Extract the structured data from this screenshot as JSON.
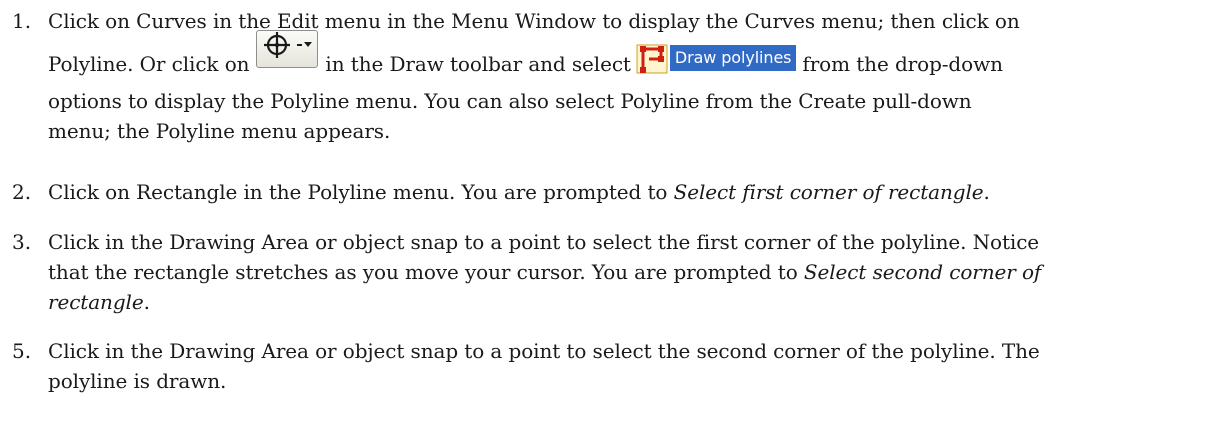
{
  "steps": [
    {
      "number": "1.",
      "line1": "Click on Curves in the Edit menu in the Menu Window to display the Curves menu; then click on",
      "line2_a": "Polyline. Or click on",
      "line2_b": "in the Draw toolbar and select",
      "line2_c": "from the drop-down",
      "line3": "options to display the Polyline menu. You can also select Polyline from the Create pull-down",
      "line4": "menu; the Polyline menu appears.",
      "menu_label": "Draw polylines",
      "toolbar_icon": "snap-target-dropdown-icon",
      "menu_icon": "polyline-icon"
    },
    {
      "number": "2.",
      "line1_a": "Click on Rectangle in the Polyline menu. You are prompted to ",
      "line1_b": "Select first corner of rectangle",
      "line1_c": "."
    },
    {
      "number": "3.",
      "line1": "Click in the Drawing Area or object snap to a point to select the first corner of the polyline. Notice",
      "line2_a": "that the rectangle stretches as you move your cursor. You are prompted to ",
      "line2_b": "Select second corner of",
      "line3_a": "rectangle",
      "line3_b": "."
    },
    {
      "number": "5.",
      "line1": "Click in the Drawing Area or object snap to a point to select the second corner of the polyline. The",
      "line2": "polyline is drawn."
    }
  ],
  "colors": {
    "text": "#1a1a1a",
    "menu_highlight": "#316ac5",
    "icon_red": "#d02010"
  }
}
